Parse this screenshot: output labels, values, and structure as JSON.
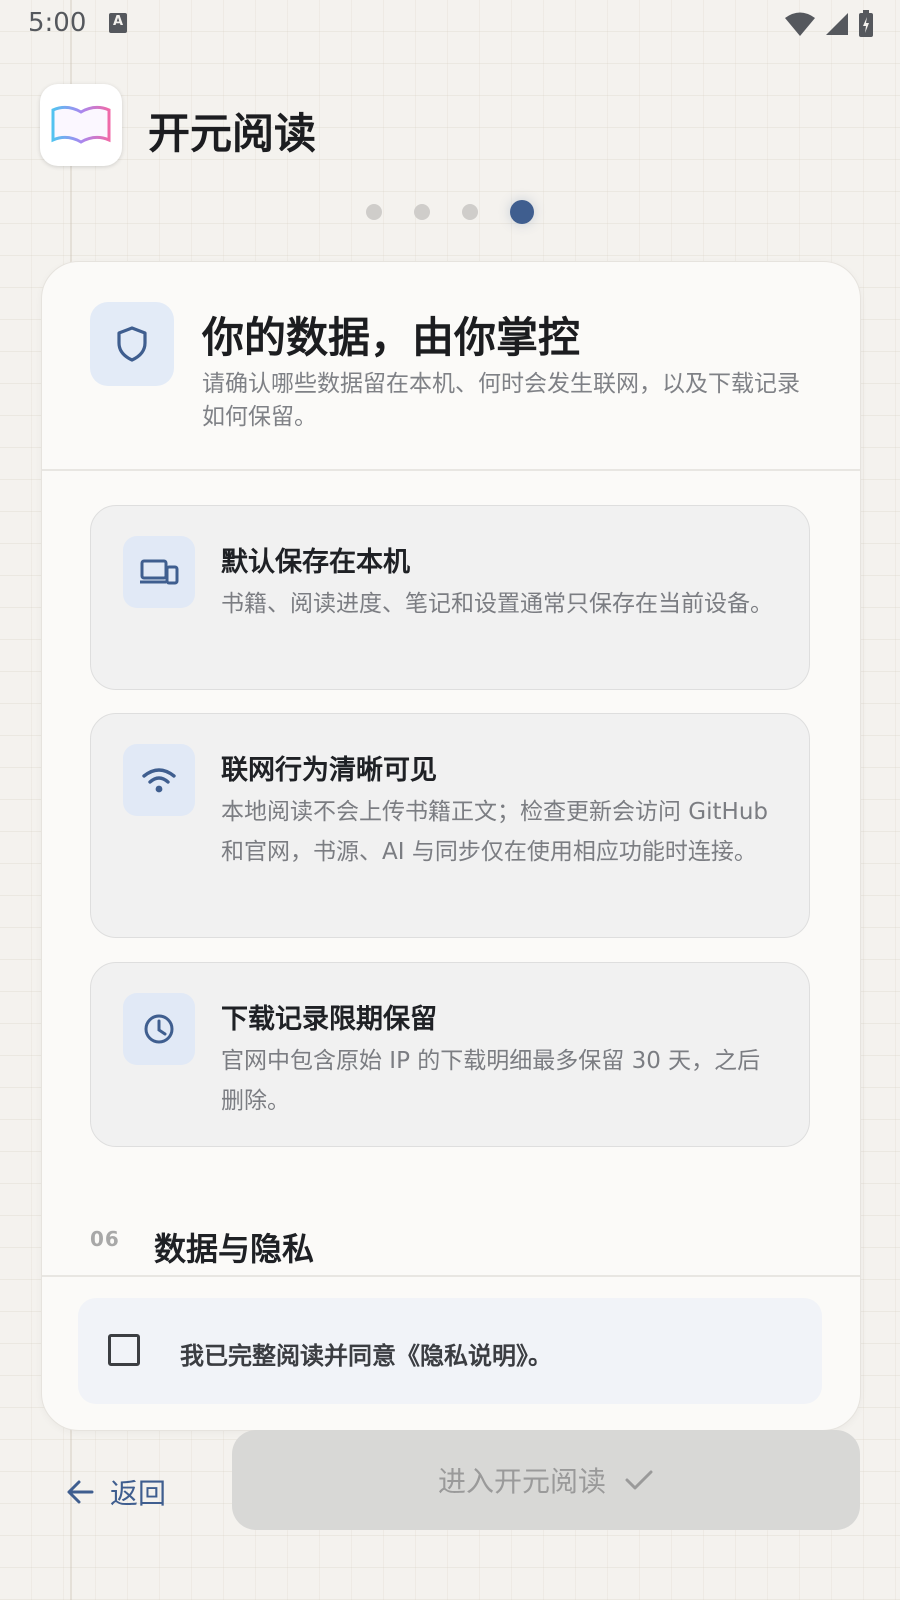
{
  "status_bar": {
    "time": "5:00",
    "notification_letter": "A"
  },
  "app": {
    "title": "开元阅读"
  },
  "pager": {
    "total": 4,
    "active_index": 3
  },
  "header": {
    "title": "你的数据，由你掌控",
    "subtitle": "请确认哪些数据留在本机、何时会发生联网，以及下载记录如何保留。"
  },
  "items": [
    {
      "icon": "devices-icon",
      "title": "默认保存在本机",
      "desc": "书籍、阅读进度、笔记和设置通常只保存在当前设备。"
    },
    {
      "icon": "wifi-icon",
      "title": "联网行为清晰可见",
      "desc": "本地阅读不会上传书籍正文；检查更新会访问 GitHub 和官网，书源、AI 与同步仅在使用相应功能时连接。"
    },
    {
      "icon": "clock-icon",
      "title": "下载记录限期保留",
      "desc": "官网中包含原始 IP 的下载明细最多保留 30 天，之后删除。"
    }
  ],
  "section": {
    "number": "06",
    "title": "数据与隐私"
  },
  "agreement": {
    "text": "我已完整阅读并同意《隐私说明》。",
    "checked": false
  },
  "actions": {
    "back_label": "返回",
    "enter_label": "进入开元阅读"
  },
  "colors": {
    "accent": "#3f5e8f",
    "icon_bg": "#e1e9f6",
    "disabled_button": "#d8d8d6"
  }
}
